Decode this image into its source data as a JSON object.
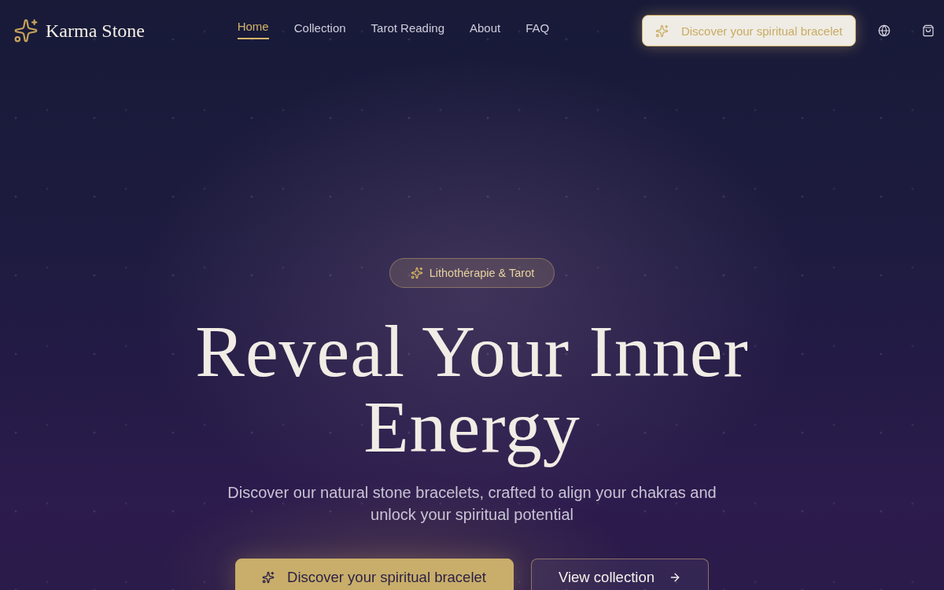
{
  "header": {
    "logo": "Karma Stone",
    "nav": [
      {
        "label": "Home",
        "selected": true
      },
      {
        "label": "Collection",
        "selected": false
      },
      {
        "label": "Tarot Reading",
        "selected": false
      },
      {
        "label": "About",
        "selected": false
      },
      {
        "label": "FAQ",
        "selected": false
      }
    ],
    "cta": "Discover your spiritual bracelet"
  },
  "hero": {
    "badge": "Lithothérapie & Tarot",
    "title": "Reveal Your Inner Energy",
    "subtitle": "Discover our natural stone bracelets, crafted to align your chakras and unlock your spiritual potential",
    "buttons": [
      {
        "label": "Discover your spiritual bracelet",
        "kind": "primary"
      },
      {
        "label": "View collection",
        "kind": "secondary"
      }
    ]
  }
}
